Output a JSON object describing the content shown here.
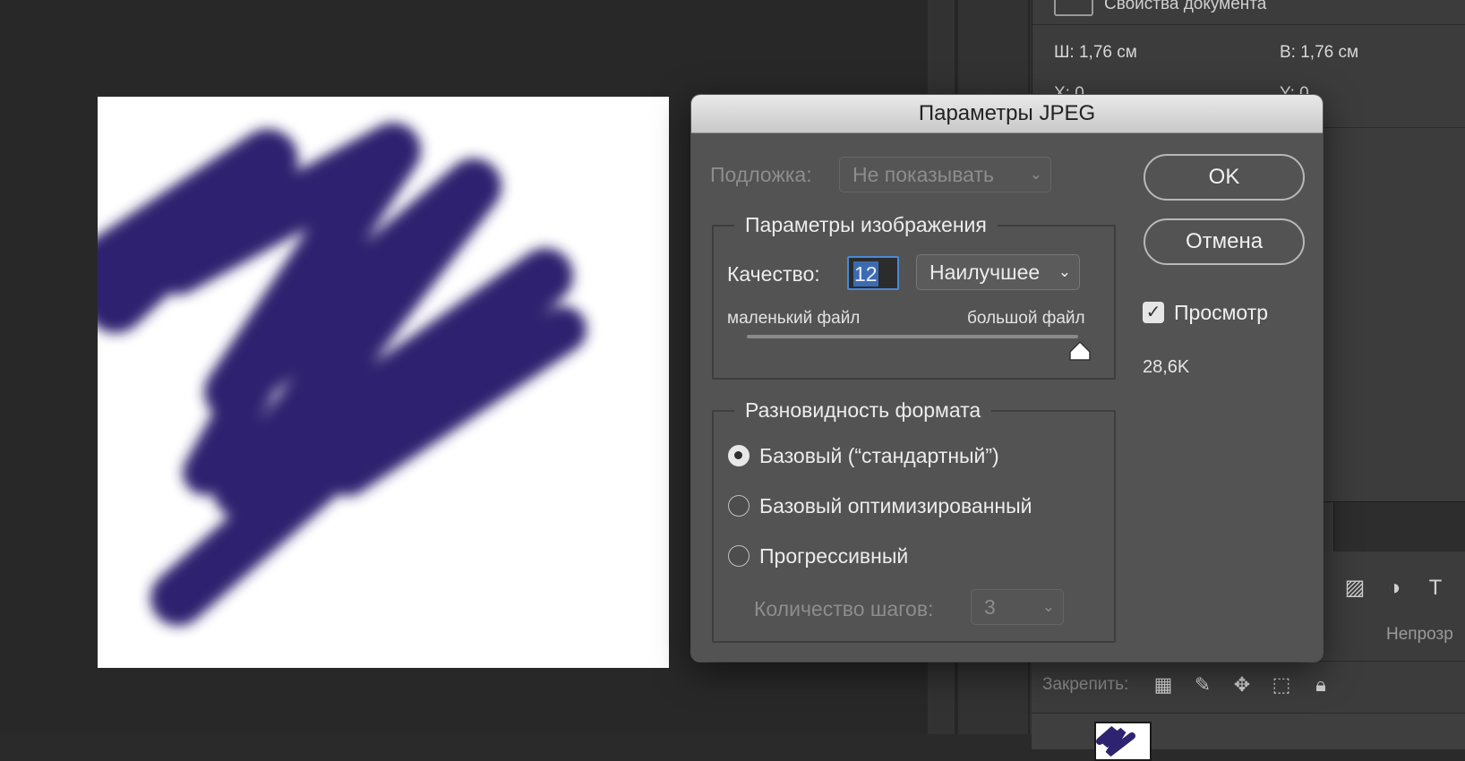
{
  "properties_panel": {
    "header": "Свойства документа",
    "width": "Ш: 1,76 см",
    "height": "В: 1,76 см",
    "x": "X: 0",
    "y": "Y: 0"
  },
  "layers_panel": {
    "opacity_label": "Непрозр",
    "lock_label": "Закрепить:",
    "filter_icons": [
      "image-icon",
      "adjustment-icon",
      "type-icon"
    ],
    "lock_icons": [
      "lock-transparent-icon",
      "lock-paint-icon",
      "lock-move-icon",
      "lock-artboard-icon",
      "lock-all-icon"
    ]
  },
  "dialog": {
    "title": "Параметры JPEG",
    "matte_label": "Подложка:",
    "matte_value": "Не показывать",
    "image_options": {
      "legend": "Параметры изображения",
      "quality_label": "Качество:",
      "quality_value": "12",
      "quality_preset": "Наилучшее",
      "small_file": "маленький файл",
      "large_file": "большой файл",
      "slider_fraction": 1.0
    },
    "format_options": {
      "legend": "Разновидность формата",
      "baseline_standard": "Базовый (“стандартный”)",
      "baseline_optimized": "Базовый оптимизированный",
      "progressive": "Прогрессивный",
      "scans_label": "Количество шагов:",
      "scans_value": "3",
      "selected": "baseline_standard"
    },
    "ok_label": "OK",
    "cancel_label": "Отмена",
    "preview_label": "Просмотр",
    "preview_checked": true,
    "file_size": "28,6K"
  },
  "colors": {
    "scribble": "#2e2370",
    "focus": "#4a88d6"
  }
}
